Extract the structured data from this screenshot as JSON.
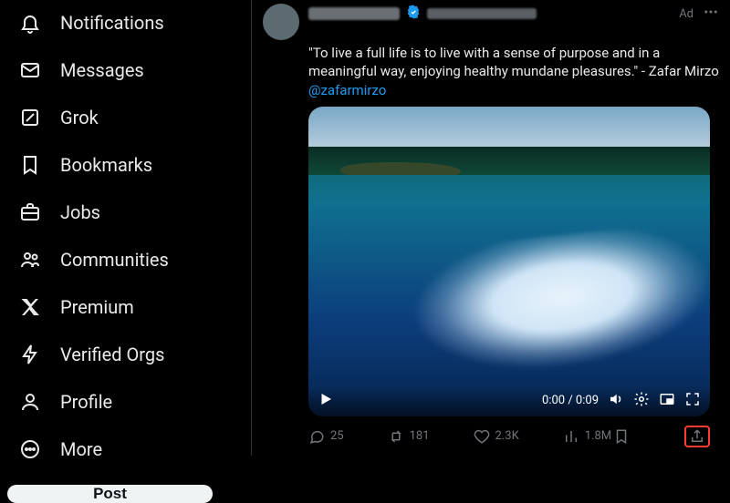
{
  "sidebar": {
    "items": [
      {
        "label": "Notifications"
      },
      {
        "label": "Messages"
      },
      {
        "label": "Grok"
      },
      {
        "label": "Bookmarks"
      },
      {
        "label": "Jobs"
      },
      {
        "label": "Communities"
      },
      {
        "label": "Premium"
      },
      {
        "label": "Verified Orgs"
      },
      {
        "label": "Profile"
      },
      {
        "label": "More"
      }
    ],
    "post_label": "Post"
  },
  "tweet": {
    "ad_label": "Ad",
    "mention": "@zafarmirzo",
    "text_before_mention": "\"To live a full life is to live with a sense of purpose and in a meaningful way, enjoying healthy mundane pleasures.\" - Zafar Mirzo ",
    "video": {
      "time": "0:00 / 0:09"
    },
    "actions": {
      "replies": "25",
      "retweets": "181",
      "likes": "2.3K",
      "views": "1.8M"
    }
  }
}
